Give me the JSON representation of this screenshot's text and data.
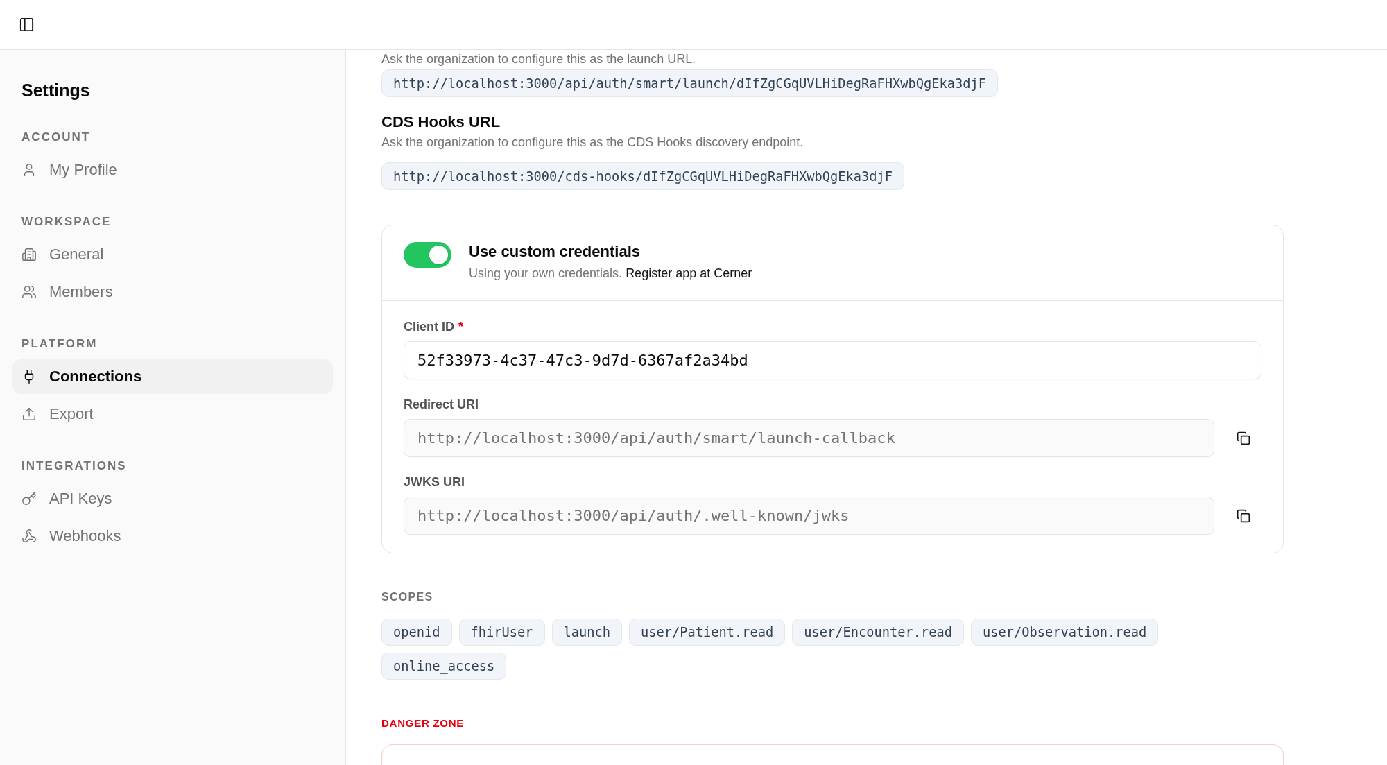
{
  "sidebar": {
    "title": "Settings",
    "sections": [
      {
        "label": "ACCOUNT",
        "items": [
          {
            "label": "My Profile",
            "selected": false
          }
        ]
      },
      {
        "label": "WORKSPACE",
        "items": [
          {
            "label": "General",
            "selected": false
          },
          {
            "label": "Members",
            "selected": false
          }
        ]
      },
      {
        "label": "PLATFORM",
        "items": [
          {
            "label": "Connections",
            "selected": true
          },
          {
            "label": "Export",
            "selected": false
          }
        ]
      },
      {
        "label": "INTEGRATIONS",
        "items": [
          {
            "label": "API Keys",
            "selected": false
          },
          {
            "label": "Webhooks",
            "selected": false
          }
        ]
      }
    ]
  },
  "launch_url": {
    "description": "Ask the organization to configure this as the launch URL.",
    "url": "http://localhost:3000/api/auth/smart/launch/dIfZgCGqUVLHiDegRaFHXwbQgEka3djF"
  },
  "cds_hooks": {
    "title": "CDS Hooks URL",
    "description": "Ask the organization to configure this as the CDS Hooks discovery endpoint.",
    "url": "http://localhost:3000/cds-hooks/dIfZgCGqUVLHiDegRaFHXwbQgEka3djF"
  },
  "credentials": {
    "on": true,
    "title": "Use custom credentials",
    "description": "Using your own credentials.",
    "link": "Register app at Cerner",
    "required_mark": "*",
    "fields": [
      {
        "label": "Client ID",
        "required": true,
        "readonly": false,
        "value": "52f33973-4c37-47c3-9d7d-6367af2a34bd"
      },
      {
        "label": "Redirect URI",
        "required": false,
        "readonly": true,
        "value": "http://localhost:3000/api/auth/smart/launch-callback"
      },
      {
        "label": "JWKS URI",
        "required": false,
        "readonly": true,
        "value": "http://localhost:3000/api/auth/.well-known/jwks"
      }
    ]
  },
  "scopes": {
    "label": "SCOPES",
    "items": [
      "openid",
      "fhirUser",
      "launch",
      "user/Patient.read",
      "user/Encounter.read",
      "user/Observation.read",
      "online_access"
    ]
  },
  "danger_zone": {
    "label": "DANGER ZONE"
  }
}
